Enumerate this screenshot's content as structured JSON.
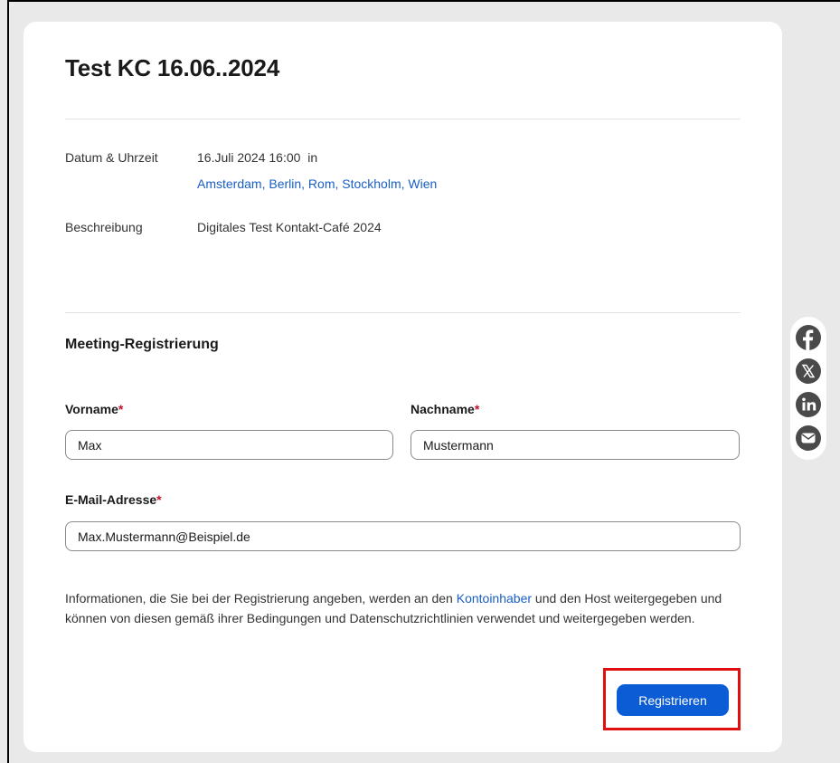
{
  "meeting": {
    "title": "Test KC 16.06..2024"
  },
  "details": {
    "datetime_label": "Datum & Uhrzeit",
    "datetime_value": "16.Juli 2024 16:00  in",
    "timezones_link": "Amsterdam, Berlin, Rom, Stockholm, Wien",
    "description_label": "Beschreibung",
    "description_value": "Digitales Test Kontakt-Café 2024"
  },
  "registration": {
    "section_title": "Meeting-Registrierung",
    "required_marker": "*",
    "first_name": {
      "label": "Vorname",
      "value": "Max"
    },
    "last_name": {
      "label": "Nachname",
      "value": "Mustermann"
    },
    "email": {
      "label": "E-Mail-Adresse",
      "value": "Max.Mustermann@Beispiel.de"
    },
    "notice_before": "Informationen, die Sie bei der Registrierung angeben, werden an den ",
    "notice_link": "Kontoinhaber",
    "notice_after": " und den Host weitergegeben und können von diesen gemäß ihrer Bedingungen und Datenschutzrichtlinien verwendet und weitergegeben werden.",
    "submit_label": "Registrieren"
  },
  "share": {
    "icons": [
      "facebook-icon",
      "x-icon",
      "linkedin-icon",
      "email-icon"
    ]
  },
  "colors": {
    "accent": "#0b5cd5",
    "link": "#1a5fc4",
    "required": "#c8102e",
    "highlight": "#e01010",
    "share_icon": "#4a4a4a"
  }
}
